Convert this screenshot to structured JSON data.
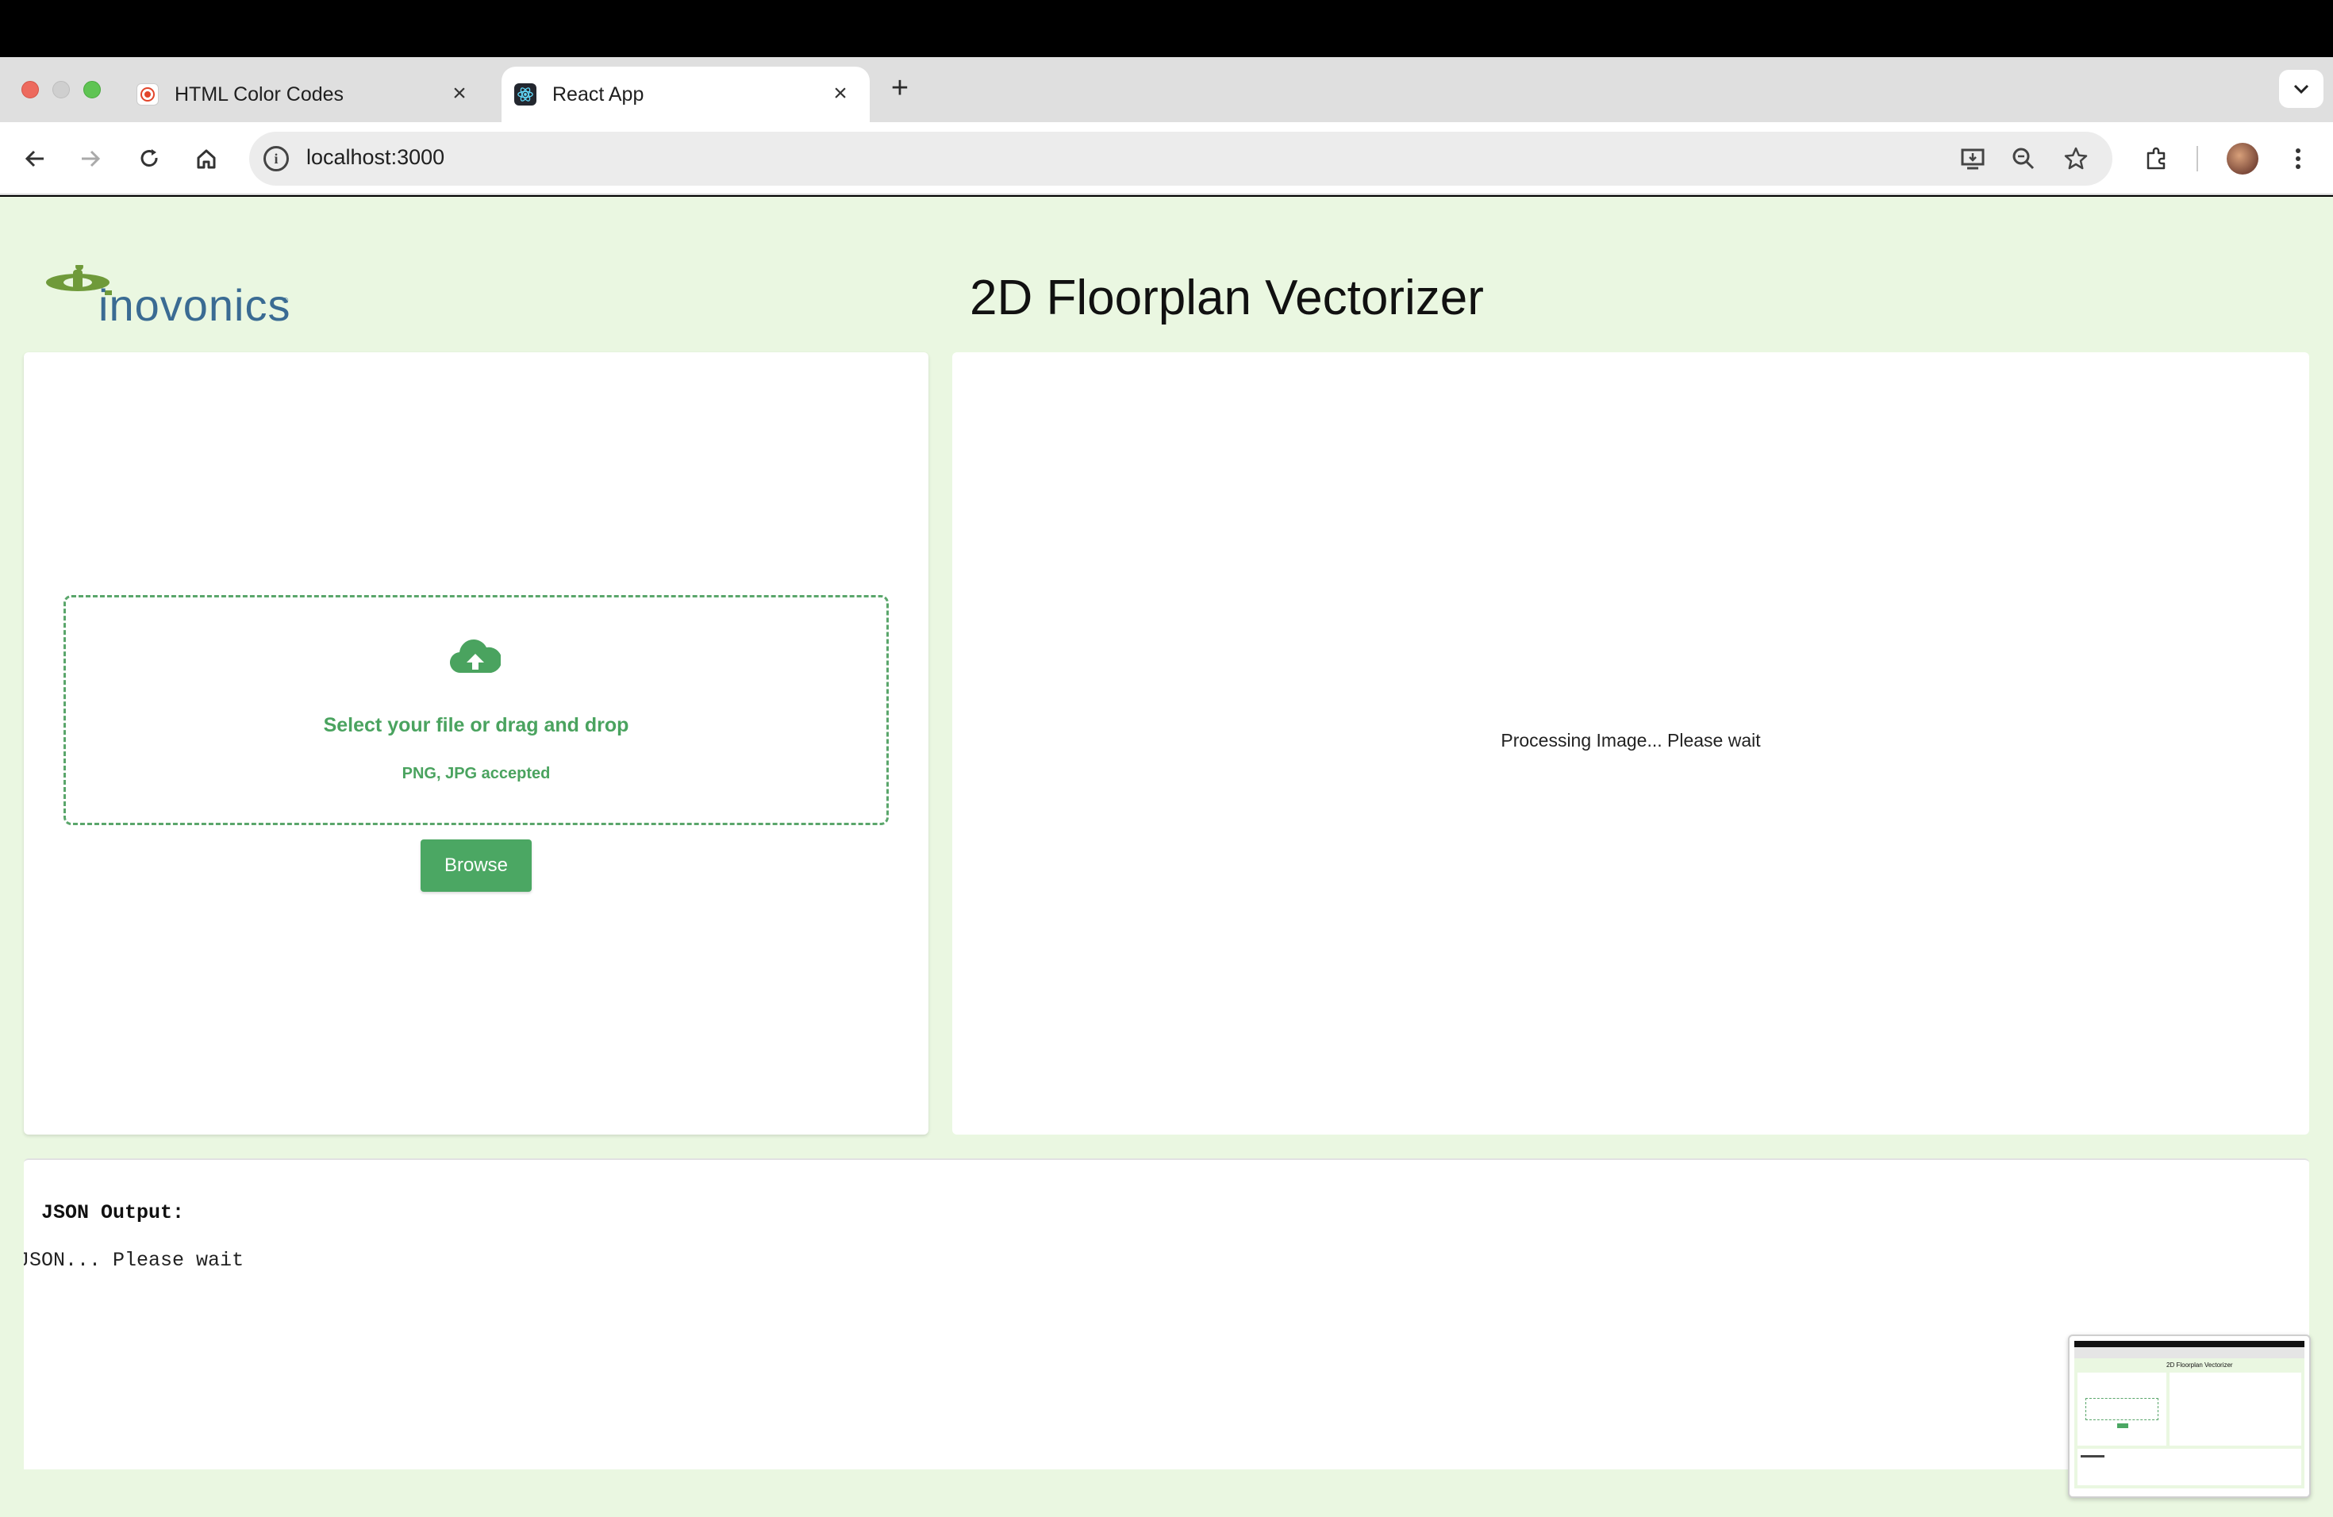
{
  "browser": {
    "tabs": [
      {
        "label": "HTML Color Codes",
        "active": false
      },
      {
        "label": "React App",
        "active": true
      }
    ],
    "new_tab_label": "+",
    "close_label": "×",
    "url": "localhost:3000"
  },
  "app": {
    "logo_text": "inovonics",
    "title": "2D Floorplan Vectorizer",
    "accent_color": "#4ba763",
    "page_bg_color": "#eaf7e1"
  },
  "upload": {
    "icon": "cloud-upload-icon",
    "title": "Select your file or drag and drop",
    "subtitle": "PNG, JPG accepted",
    "button_label": "Browse"
  },
  "preview": {
    "status": "Processing Image... Please wait"
  },
  "json_output": {
    "label": "JSON Output:",
    "status": "Loading JSON... Please wait"
  },
  "thumbnail": {
    "title": "2D Floorplan Vectorizer"
  }
}
